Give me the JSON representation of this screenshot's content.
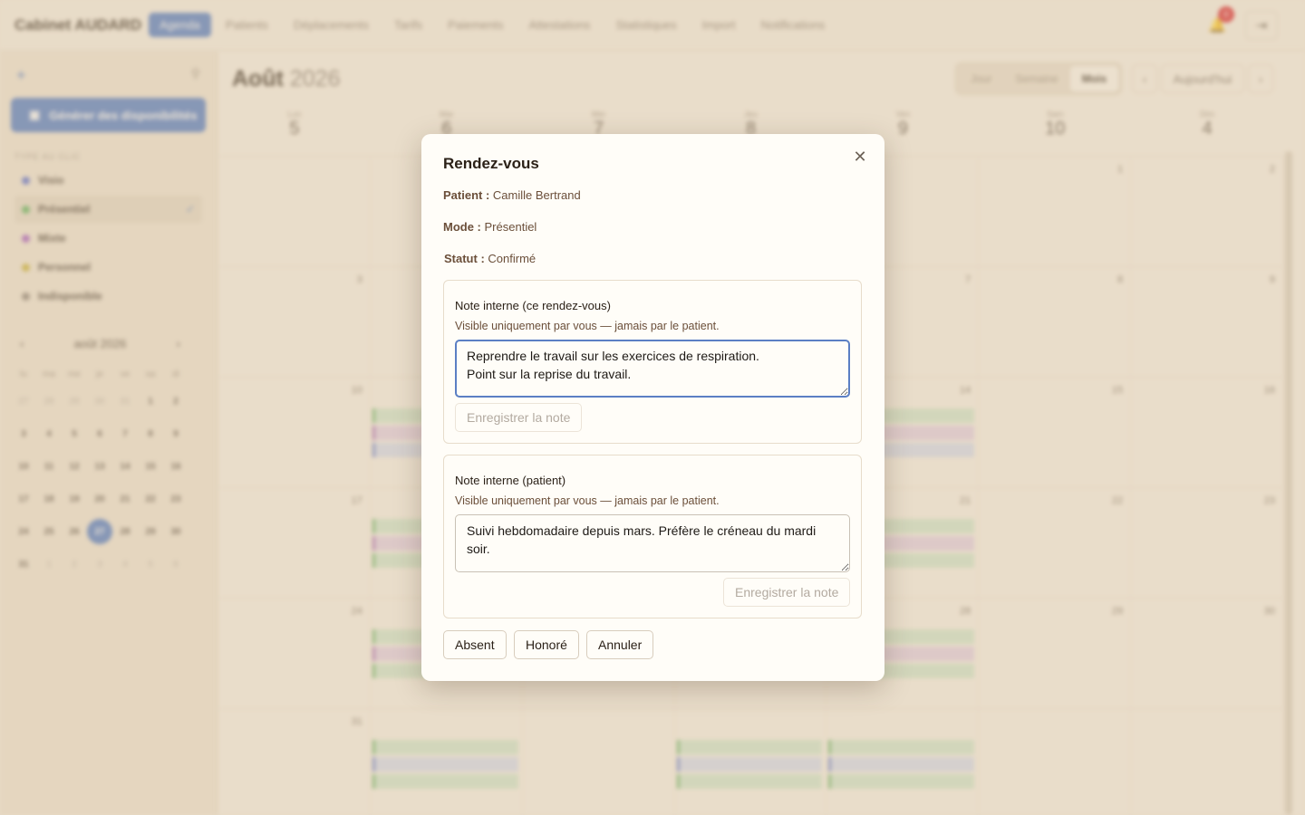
{
  "app": {
    "brand": "Cabinet AUDARD",
    "nav": [
      "Agenda",
      "Patients",
      "Déplacements",
      "Tarifs",
      "Paiements",
      "Attestations",
      "Statistiques",
      "Import",
      "Notifications"
    ],
    "notification_count": "0"
  },
  "sidebar": {
    "generate_label": "Générer des disponibilités",
    "types_heading": "TYPE AU CLIC",
    "types": [
      {
        "label": "Visio",
        "color": "#5b6fd0"
      },
      {
        "label": "Présentiel",
        "color": "#5fb35f"
      },
      {
        "label": "Mixte",
        "color": "#a65bc2"
      },
      {
        "label": "Personnel",
        "color": "#c9b23a"
      },
      {
        "label": "Indisponible",
        "color": "#8f857b"
      }
    ],
    "mini_cal": {
      "title": "août 2026",
      "dow": [
        "lu",
        "ma",
        "me",
        "je",
        "ve",
        "sa",
        "di"
      ],
      "weeks": [
        [
          "27",
          "28",
          "29",
          "30",
          "31",
          "1",
          "2"
        ],
        [
          "3",
          "4",
          "5",
          "6",
          "7",
          "8",
          "9"
        ],
        [
          "10",
          "11",
          "12",
          "13",
          "14",
          "15",
          "16"
        ],
        [
          "17",
          "18",
          "19",
          "20",
          "21",
          "22",
          "23"
        ],
        [
          "24",
          "25",
          "26",
          "27",
          "28",
          "29",
          "30"
        ],
        [
          "31",
          "1",
          "2",
          "3",
          "4",
          "5",
          "6"
        ]
      ],
      "today": "27"
    }
  },
  "calendar": {
    "month": "Août",
    "year": "2026",
    "views": [
      "Jour",
      "Semaine",
      "Mois"
    ],
    "active_view": "Mois",
    "today_label": "Aujourd'hui",
    "header_days": [
      {
        "dow": "Lun",
        "num": "5"
      },
      {
        "dow": "Mar",
        "num": "6"
      },
      {
        "dow": "Mer",
        "num": "7"
      },
      {
        "dow": "Jeu",
        "num": "8"
      },
      {
        "dow": "Ven",
        "num": "9"
      },
      {
        "dow": "Sam",
        "num": "10"
      },
      {
        "dow": "Dim",
        "num": "4"
      }
    ],
    "rows": [
      [
        "",
        "",
        "",
        "",
        "",
        "1",
        "2"
      ],
      [
        "3",
        "",
        "",
        "",
        "7",
        "8",
        "9"
      ],
      [
        "10",
        "",
        "",
        "",
        "14",
        "15",
        "16"
      ],
      [
        "17",
        "",
        "",
        "",
        "21",
        "22",
        "23"
      ],
      [
        "24",
        "",
        "",
        "",
        "28",
        "29",
        "30"
      ],
      [
        "31",
        "",
        "",
        "",
        "",
        "",
        ""
      ]
    ]
  },
  "modal": {
    "title": "Rendez-vous",
    "patient_label": "Patient :",
    "patient": "Camille Bertrand",
    "mode_label": "Mode :",
    "mode": "Présentiel",
    "status_label": "Statut :",
    "status": "Confirmé",
    "note_rdv": {
      "title": "Note interne (ce rendez-vous)",
      "desc": "Visible uniquement par vous — jamais par le patient.",
      "value": "Reprendre le travail sur les exercices de respiration.\nPoint sur la reprise du travail.",
      "save": "Enregistrer la note"
    },
    "note_patient": {
      "title": "Note interne (patient)",
      "desc": "Visible uniquement par vous — jamais par le patient.",
      "value": "Suivi hebdomadaire depuis mars. Préfère le créneau du mardi soir.",
      "save": "Enregistrer la note"
    },
    "actions": {
      "absent": "Absent",
      "honore": "Honoré",
      "annuler": "Annuler"
    }
  }
}
